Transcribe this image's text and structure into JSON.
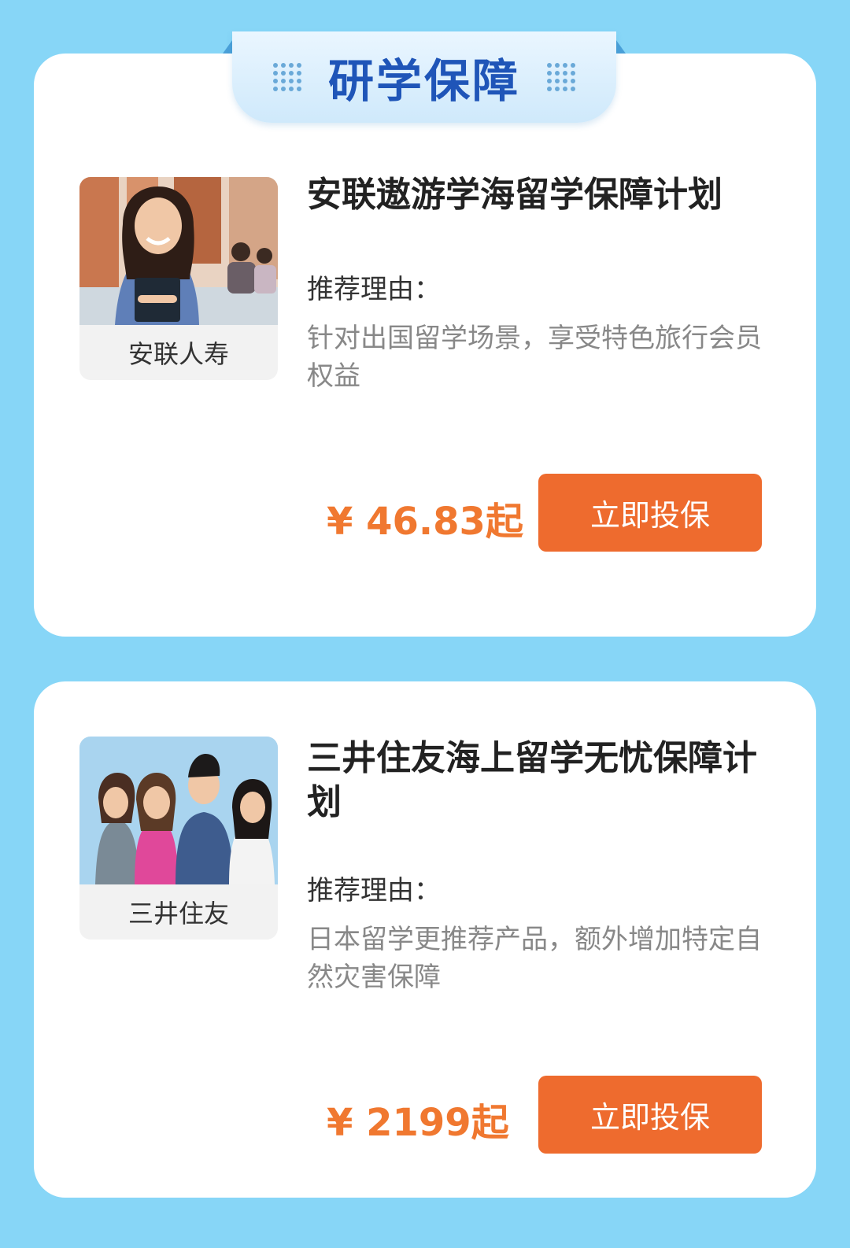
{
  "header": {
    "title": "研学保障"
  },
  "products": [
    {
      "company": "安联人寿",
      "title": "安联遨游学海留学保障计划",
      "reason_label": "推荐理由：",
      "reason": "针对出国留学场景，享受特色旅行会员权益",
      "price": "¥ 46.83起",
      "button": "立即投保"
    },
    {
      "company": "三井住友",
      "title": "三井住友海上留学无忧保障计划",
      "reason_label": "推荐理由：",
      "reason": "日本留学更推荐产品，额外增加特定自然灾害保障",
      "price": "¥ 2199起",
      "button": "立即投保"
    }
  ],
  "colors": {
    "background": "#87d6f7",
    "title_blue": "#1f55b8",
    "accent_orange": "#ee6b2e",
    "price_orange": "#f07830"
  }
}
